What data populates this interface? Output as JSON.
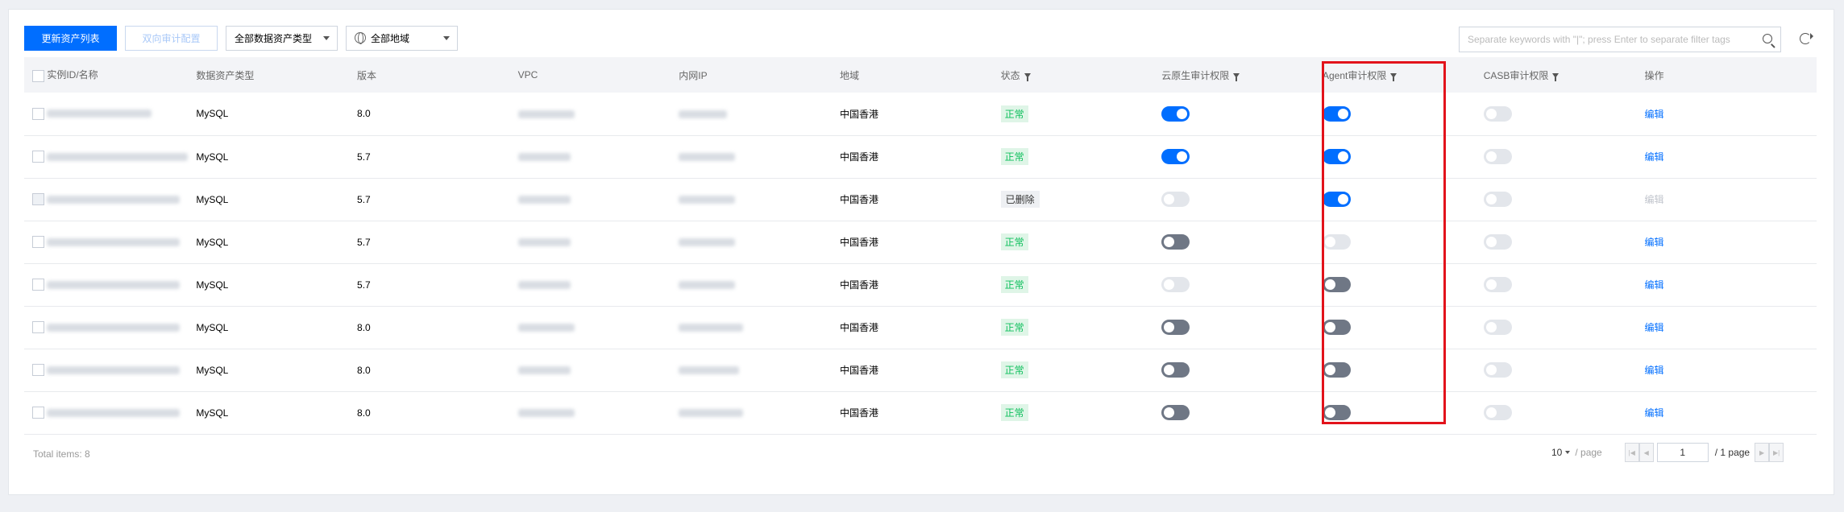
{
  "toolbar": {
    "update_button": "更新资产列表",
    "bidirectional_button": "双向审计配置",
    "asset_type_select": "全部数据资产类型",
    "region_select": "全部地域"
  },
  "search": {
    "placeholder": "Separate keywords with \"|\"; press Enter to separate filter tags"
  },
  "table": {
    "headers": {
      "instance": "实例ID/名称",
      "type": "数据资产类型",
      "version": "版本",
      "vpc": "VPC",
      "ip": "内网IP",
      "region": "地域",
      "status": "状态",
      "cloud_native": "云原生审计权限",
      "agent": "Agent审计权限",
      "casb": "CASB审计权限",
      "action": "操作"
    },
    "rows": [
      {
        "type": "MySQL",
        "version": "8.0",
        "region": "中国香港",
        "status": "正常",
        "status_kind": "ok",
        "cloud_native": "on",
        "agent": "on",
        "casb": "disabled",
        "action": "编辑",
        "action_enabled": true
      },
      {
        "type": "MySQL",
        "version": "5.7",
        "region": "中国香港",
        "status": "正常",
        "status_kind": "ok",
        "cloud_native": "on",
        "agent": "on",
        "casb": "disabled",
        "action": "编辑",
        "action_enabled": true
      },
      {
        "type": "MySQL",
        "version": "5.7",
        "region": "中国香港",
        "status": "已删除",
        "status_kind": "deleted",
        "cloud_native": "disabled",
        "agent": "on",
        "casb": "disabled",
        "action": "编辑",
        "action_enabled": false
      },
      {
        "type": "MySQL",
        "version": "5.7",
        "region": "中国香港",
        "status": "正常",
        "status_kind": "ok",
        "cloud_native": "off",
        "agent": "disabled",
        "casb": "disabled",
        "action": "编辑",
        "action_enabled": true
      },
      {
        "type": "MySQL",
        "version": "5.7",
        "region": "中国香港",
        "status": "正常",
        "status_kind": "ok",
        "cloud_native": "disabled",
        "agent": "off",
        "casb": "disabled",
        "action": "编辑",
        "action_enabled": true
      },
      {
        "type": "MySQL",
        "version": "8.0",
        "region": "中国香港",
        "status": "正常",
        "status_kind": "ok",
        "cloud_native": "off",
        "agent": "off",
        "casb": "disabled",
        "action": "编辑",
        "action_enabled": true
      },
      {
        "type": "MySQL",
        "version": "8.0",
        "region": "中国香港",
        "status": "正常",
        "status_kind": "ok",
        "cloud_native": "off",
        "agent": "off",
        "casb": "disabled",
        "action": "编辑",
        "action_enabled": true
      },
      {
        "type": "MySQL",
        "version": "8.0",
        "region": "中国香港",
        "status": "正常",
        "status_kind": "ok",
        "cloud_native": "off",
        "agent": "off",
        "casb": "disabled",
        "action": "编辑",
        "action_enabled": true
      }
    ]
  },
  "footer": {
    "total": "Total items: 8",
    "page_size": "10",
    "per_page": "/ page",
    "current_page": "1",
    "total_pages": "/ 1 page"
  },
  "colors": {
    "accent": "#006eff",
    "highlight": "#e2131b",
    "ok_text": "#0cbf5b"
  }
}
